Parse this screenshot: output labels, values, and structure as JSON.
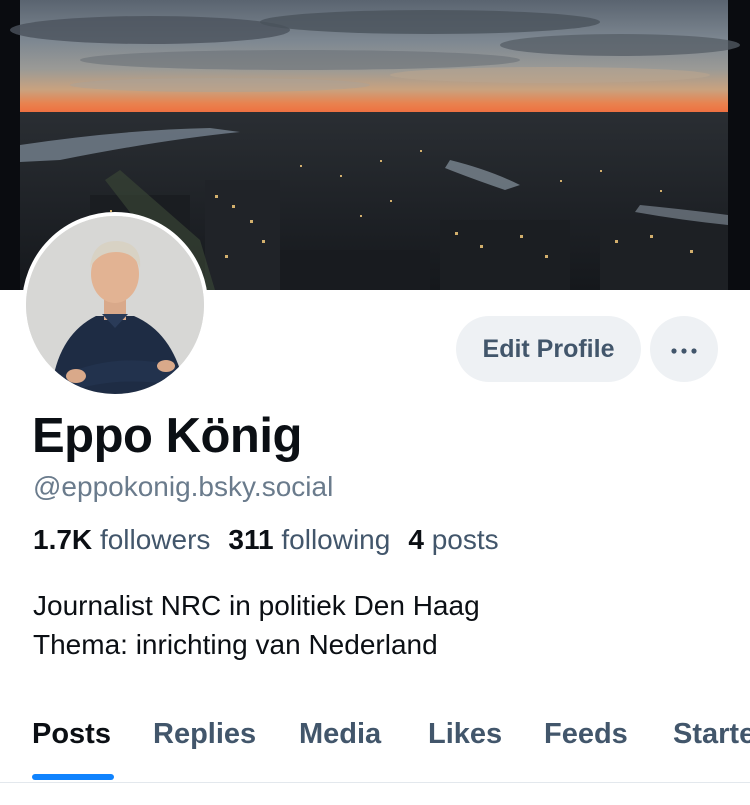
{
  "banner": {
    "description_icon": "city-skyline-sunset-banner"
  },
  "profile": {
    "display_name": "Eppo König",
    "handle": "@eppokonig.bsky.social",
    "followers_count": "1.7K",
    "followers_label": "followers",
    "following_count": "311",
    "following_label": "following",
    "posts_count": "4",
    "posts_label": "posts",
    "bio_line_1": "Journalist NRC in politiek Den Haag",
    "bio_line_2": "Thema: inrichting van Nederland"
  },
  "actions": {
    "edit_label": "Edit Profile",
    "more_icon": "more-horizontal-icon"
  },
  "tabs": [
    {
      "label": "Posts",
      "active": true
    },
    {
      "label": "Replies",
      "active": false
    },
    {
      "label": "Media",
      "active": false
    },
    {
      "label": "Likes",
      "active": false
    },
    {
      "label": "Feeds",
      "active": false
    },
    {
      "label": "Starter Packs",
      "active": false
    }
  ],
  "colors": {
    "accent": "#1083fe",
    "secondary_text": "#42566b",
    "handle_text": "#6a7b8c",
    "button_bg": "#eef1f4"
  }
}
